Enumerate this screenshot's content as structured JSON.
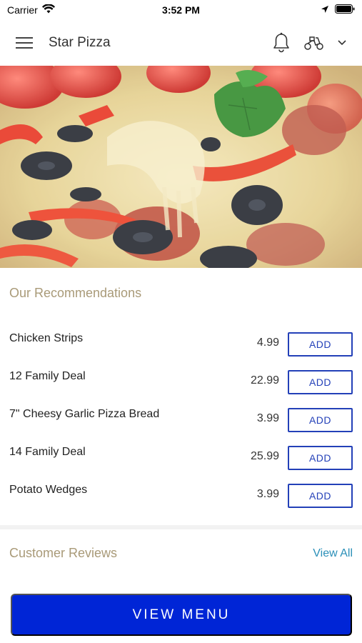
{
  "status_bar": {
    "carrier": "Carrier",
    "time": "3:52 PM"
  },
  "header": {
    "title": "Star Pizza",
    "menu_icon": "hamburger-menu-icon",
    "notification_icon": "bell-icon",
    "delivery_icon": "scooter-icon",
    "dropdown_icon": "chevron-down-icon"
  },
  "hero": {
    "image": "pizza-closeup"
  },
  "recommendations": {
    "title": "Our Recommendations",
    "items": [
      {
        "name": "Chicken Strips",
        "price": "4.99",
        "button": "ADD"
      },
      {
        "name": "12 Family Deal",
        "price": "22.99",
        "button": "ADD"
      },
      {
        "name": "7\" Cheesy Garlic Pizza Bread",
        "price": "3.99",
        "button": "ADD"
      },
      {
        "name": "14 Family Deal",
        "price": "25.99",
        "button": "ADD"
      },
      {
        "name": "Potato Wedges",
        "price": "3.99",
        "button": "ADD"
      }
    ]
  },
  "reviews": {
    "title": "Customer Reviews",
    "view_all": "View All"
  },
  "cta": {
    "label": "VIEW MENU"
  },
  "colors": {
    "accent": "#0025d6",
    "add_button": "#2340b8",
    "section_title": "#a99a78",
    "link": "#2a8fb8"
  }
}
